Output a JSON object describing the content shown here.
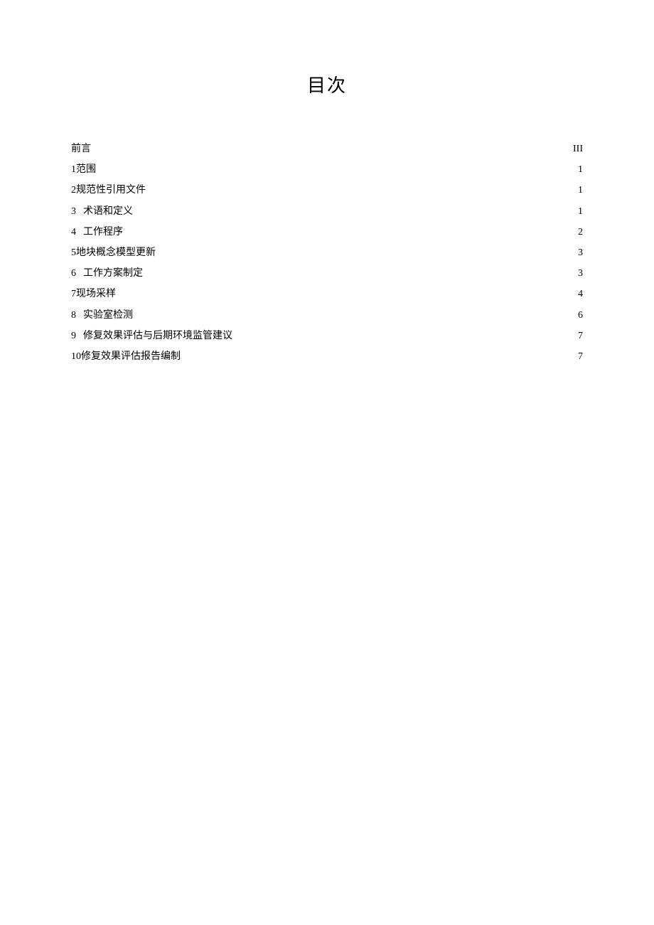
{
  "title": "目次",
  "toc": [
    {
      "num": "",
      "text": "前言",
      "page": "III",
      "spaced": false
    },
    {
      "num": "1",
      "text": "范围",
      "page": "1",
      "spaced": false
    },
    {
      "num": "2",
      "text": "规范性引用文件",
      "page": "1",
      "spaced": false
    },
    {
      "num": "3",
      "text": "术语和定义",
      "page": "1",
      "spaced": true
    },
    {
      "num": "4",
      "text": "工作程序",
      "page": "2",
      "spaced": true
    },
    {
      "num": "5",
      "text": "地块概念模型更新",
      "page": "3",
      "spaced": false
    },
    {
      "num": "6",
      "text": "工作方案制定",
      "page": "3",
      "spaced": true
    },
    {
      "num": "7",
      "text": "现场采样",
      "page": "4",
      "spaced": false
    },
    {
      "num": "8",
      "text": "实验室检测",
      "page": "6",
      "spaced": true
    },
    {
      "num": "9",
      "text": "修复效果评估与后期环境监管建议",
      "page": "7",
      "spaced": true
    },
    {
      "num": "10",
      "text": "修复效果评估报告编制",
      "page": "7",
      "spaced": false
    }
  ]
}
